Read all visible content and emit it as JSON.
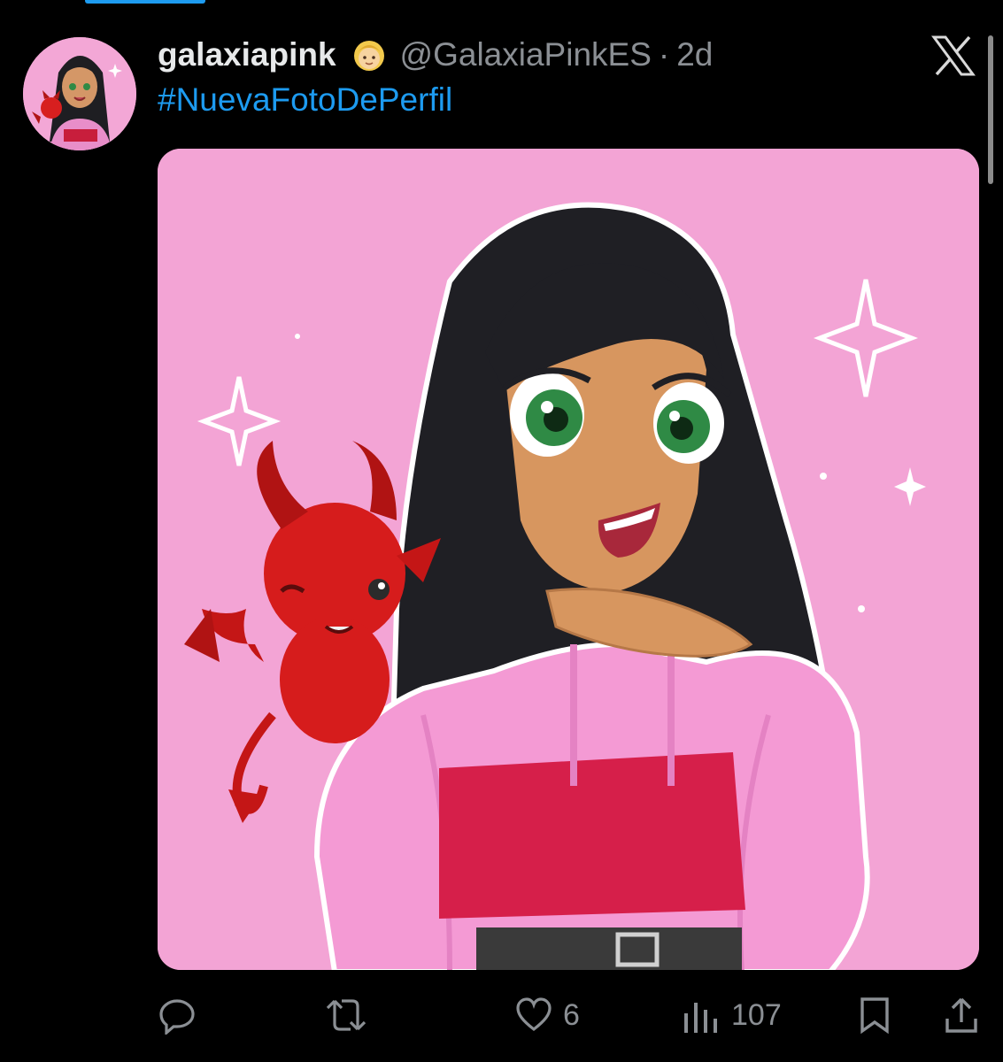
{
  "tweet": {
    "display_name": "galaxiapink",
    "handle": "@GalaxiaPinkES",
    "separator": "·",
    "time": "2d",
    "hashtag": "#NuevaFotoDePerfil",
    "emoji": "blond-girl-emoji"
  },
  "actions": {
    "reply_icon": "reply-icon",
    "retweet_icon": "retweet-icon",
    "like_icon": "heart-icon",
    "like_count": "6",
    "views_icon": "views-icon",
    "views_count": "107",
    "bookmark_icon": "bookmark-icon",
    "share_icon": "share-icon"
  },
  "colors": {
    "background": "#000000",
    "link": "#1d9bf0",
    "muted": "#8b8f94",
    "text": "#e7e9ea",
    "media_pink": "#f3a4d5"
  }
}
